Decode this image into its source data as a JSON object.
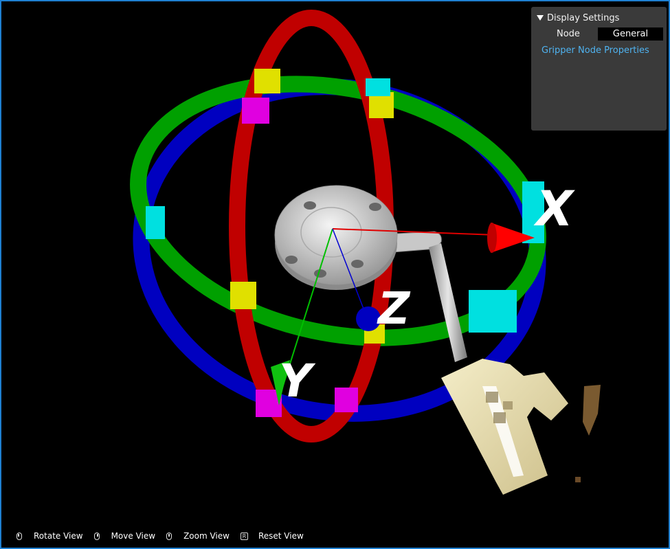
{
  "panel": {
    "title": "Display Settings",
    "node_label": "Node",
    "node_value": "General",
    "properties_link": "Gripper Node Properties"
  },
  "axes": {
    "x": "X",
    "y": "Y",
    "z": "Z"
  },
  "hints": [
    {
      "icon": "left-mouse-icon",
      "label": "Rotate View"
    },
    {
      "icon": "right-mouse-icon",
      "label": "Move View"
    },
    {
      "icon": "middle-mouse-icon",
      "label": "Zoom View"
    },
    {
      "icon": "r-key-icon",
      "key": "R",
      "label": "Reset View"
    }
  ],
  "colors": {
    "frame_border": "#1e7fd0",
    "ring_x": "#c00000",
    "ring_y": "#00a000",
    "ring_z": "#0000c0",
    "overlap_xy": "#e0e000",
    "overlap_xz": "#e000e0",
    "overlap_yz": "#00e0e0",
    "link": "#4fb3f0",
    "panel_bg": "#3a3a3a"
  }
}
